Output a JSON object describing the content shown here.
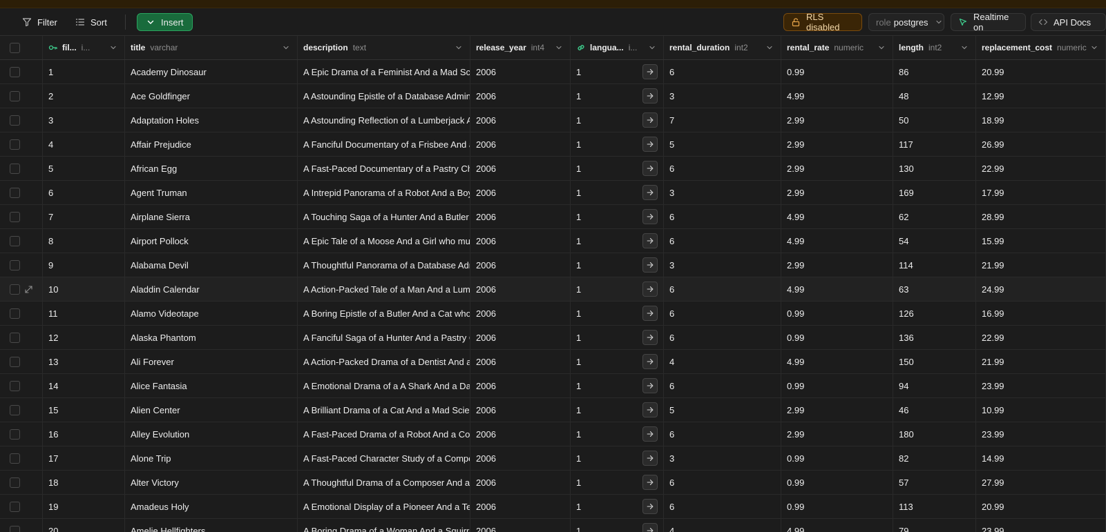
{
  "toolbar": {
    "filter_label": "Filter",
    "sort_label": "Sort",
    "insert_label": "Insert",
    "rls_label": "RLS disabled",
    "role_prefix": "role",
    "role_value": "postgres",
    "realtime_label": "Realtime on",
    "api_docs_label": "API Docs"
  },
  "columns": [
    {
      "name": "fil...",
      "type": "i...",
      "key": "key-icon"
    },
    {
      "name": "title",
      "type": "varchar"
    },
    {
      "name": "description",
      "type": "text"
    },
    {
      "name": "release_year",
      "type": "int4"
    },
    {
      "name": "langua...",
      "type": "i...",
      "key": "link-icon"
    },
    {
      "name": "rental_duration",
      "type": "int2"
    },
    {
      "name": "rental_rate",
      "type": "numeric"
    },
    {
      "name": "length",
      "type": "int2"
    },
    {
      "name": "replacement_cost",
      "type": "numeric"
    }
  ],
  "rows": [
    [
      "1",
      "Academy Dinosaur",
      "A Epic Drama of a Feminist And a Mad Scientist",
      "2006",
      "1",
      "6",
      "0.99",
      "86",
      "20.99"
    ],
    [
      "2",
      "Ace Goldfinger",
      "A Astounding Epistle of a Database Administrator",
      "2006",
      "1",
      "3",
      "4.99",
      "48",
      "12.99"
    ],
    [
      "3",
      "Adaptation Holes",
      "A Astounding Reflection of a Lumberjack And a Car",
      "2006",
      "1",
      "7",
      "2.99",
      "50",
      "18.99"
    ],
    [
      "4",
      "Affair Prejudice",
      "A Fanciful Documentary of a Frisbee And a Lumberjack",
      "2006",
      "1",
      "5",
      "2.99",
      "117",
      "26.99"
    ],
    [
      "5",
      "African Egg",
      "A Fast-Paced Documentary of a Pastry Chef And a Dentist",
      "2006",
      "1",
      "6",
      "2.99",
      "130",
      "22.99"
    ],
    [
      "6",
      "Agent Truman",
      "A Intrepid Panorama of a Robot And a Boy",
      "2006",
      "1",
      "3",
      "2.99",
      "169",
      "17.99"
    ],
    [
      "7",
      "Airplane Sierra",
      "A Touching Saga of a Hunter And a Butler",
      "2006",
      "1",
      "6",
      "4.99",
      "62",
      "28.99"
    ],
    [
      "8",
      "Airport Pollock",
      "A Epic Tale of a Moose And a Girl who must Confront",
      "2006",
      "1",
      "6",
      "4.99",
      "54",
      "15.99"
    ],
    [
      "9",
      "Alabama Devil",
      "A Thoughtful Panorama of a Database Administrator",
      "2006",
      "1",
      "3",
      "2.99",
      "114",
      "21.99"
    ],
    [
      "10",
      "Aladdin Calendar",
      "A Action-Packed Tale of a Man And a Lumberjack",
      "2006",
      "1",
      "6",
      "4.99",
      "63",
      "24.99"
    ],
    [
      "11",
      "Alamo Videotape",
      "A Boring Epistle of a Butler And a Cat who must Fight",
      "2006",
      "1",
      "6",
      "0.99",
      "126",
      "16.99"
    ],
    [
      "12",
      "Alaska Phantom",
      "A Fanciful Saga of a Hunter And a Pastry Chef",
      "2006",
      "1",
      "6",
      "0.99",
      "136",
      "22.99"
    ],
    [
      "13",
      "Ali Forever",
      "A Action-Packed Drama of a Dentist And a Crocodile",
      "2006",
      "1",
      "4",
      "4.99",
      "150",
      "21.99"
    ],
    [
      "14",
      "Alice Fantasia",
      "A Emotional Drama of a A Shark And a Database Administrator",
      "2006",
      "1",
      "6",
      "0.99",
      "94",
      "23.99"
    ],
    [
      "15",
      "Alien Center",
      "A Brilliant Drama of a Cat And a Mad Scientist",
      "2006",
      "1",
      "5",
      "2.99",
      "46",
      "10.99"
    ],
    [
      "16",
      "Alley Evolution",
      "A Fast-Paced Drama of a Robot And a Composer",
      "2006",
      "1",
      "6",
      "2.99",
      "180",
      "23.99"
    ],
    [
      "17",
      "Alone Trip",
      "A Fast-Paced Character Study of a Composer And a Dog",
      "2006",
      "1",
      "3",
      "0.99",
      "82",
      "14.99"
    ],
    [
      "18",
      "Alter Victory",
      "A Thoughtful Drama of a Composer And a Feminist",
      "2006",
      "1",
      "6",
      "0.99",
      "57",
      "27.99"
    ],
    [
      "19",
      "Amadeus Holy",
      "A Emotional Display of a Pioneer And a Technical Writer",
      "2006",
      "1",
      "6",
      "0.99",
      "113",
      "20.99"
    ],
    [
      "20",
      "Amelie Hellfighters",
      "A Boring Drama of a Woman And a Squirrel",
      "2006",
      "1",
      "4",
      "4.99",
      "79",
      "23.99"
    ]
  ]
}
